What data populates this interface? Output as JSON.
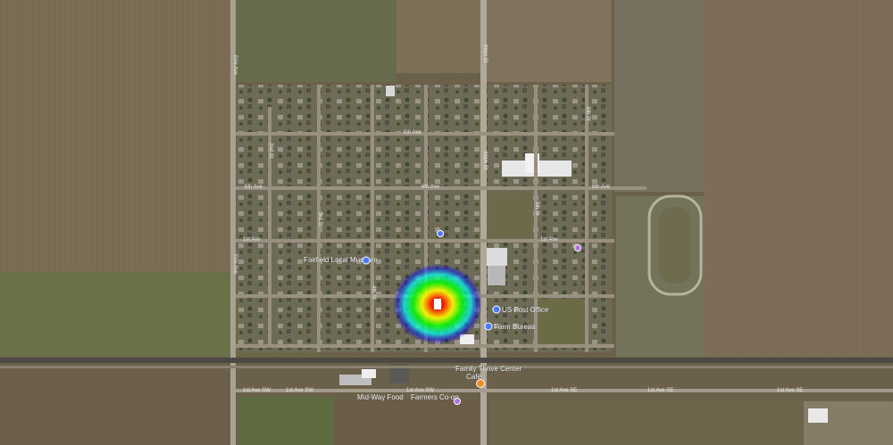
{
  "map": {
    "view": "satellite",
    "streets": {
      "vertical_left": "Erie Ave",
      "vertical_center": "Main St",
      "avenue_upper": "8th Ave",
      "avenue_middle": "6th Ave",
      "avenue_lower": "1st Ave",
      "street_2nd": "2nd St",
      "street_3rd": "3rd St",
      "street_4th": "4th St",
      "street_5th": "5th St",
      "street_6th": "6th St",
      "road_south_left": "1st Ave SW",
      "road_south_right": "1st Ave SE"
    },
    "pois": {
      "museum": "Fairfield Local Museum",
      "post_office": "US Post Office",
      "farm_bureau": "Farm Bureau",
      "family_center": "Family Thrive Center",
      "cafe": "Café",
      "store_left": "Mid-Way Food",
      "store_right": "Farmers Co-op"
    },
    "heatmap": {
      "colors": [
        "#ff0000",
        "#ffff00",
        "#00ff00",
        "#00ffff",
        "#0000ff"
      ]
    },
    "icon_colors": {
      "blue_marker": "#4d79ff",
      "orange_marker": "#f08a24",
      "purple_marker": "#b072e0"
    }
  }
}
